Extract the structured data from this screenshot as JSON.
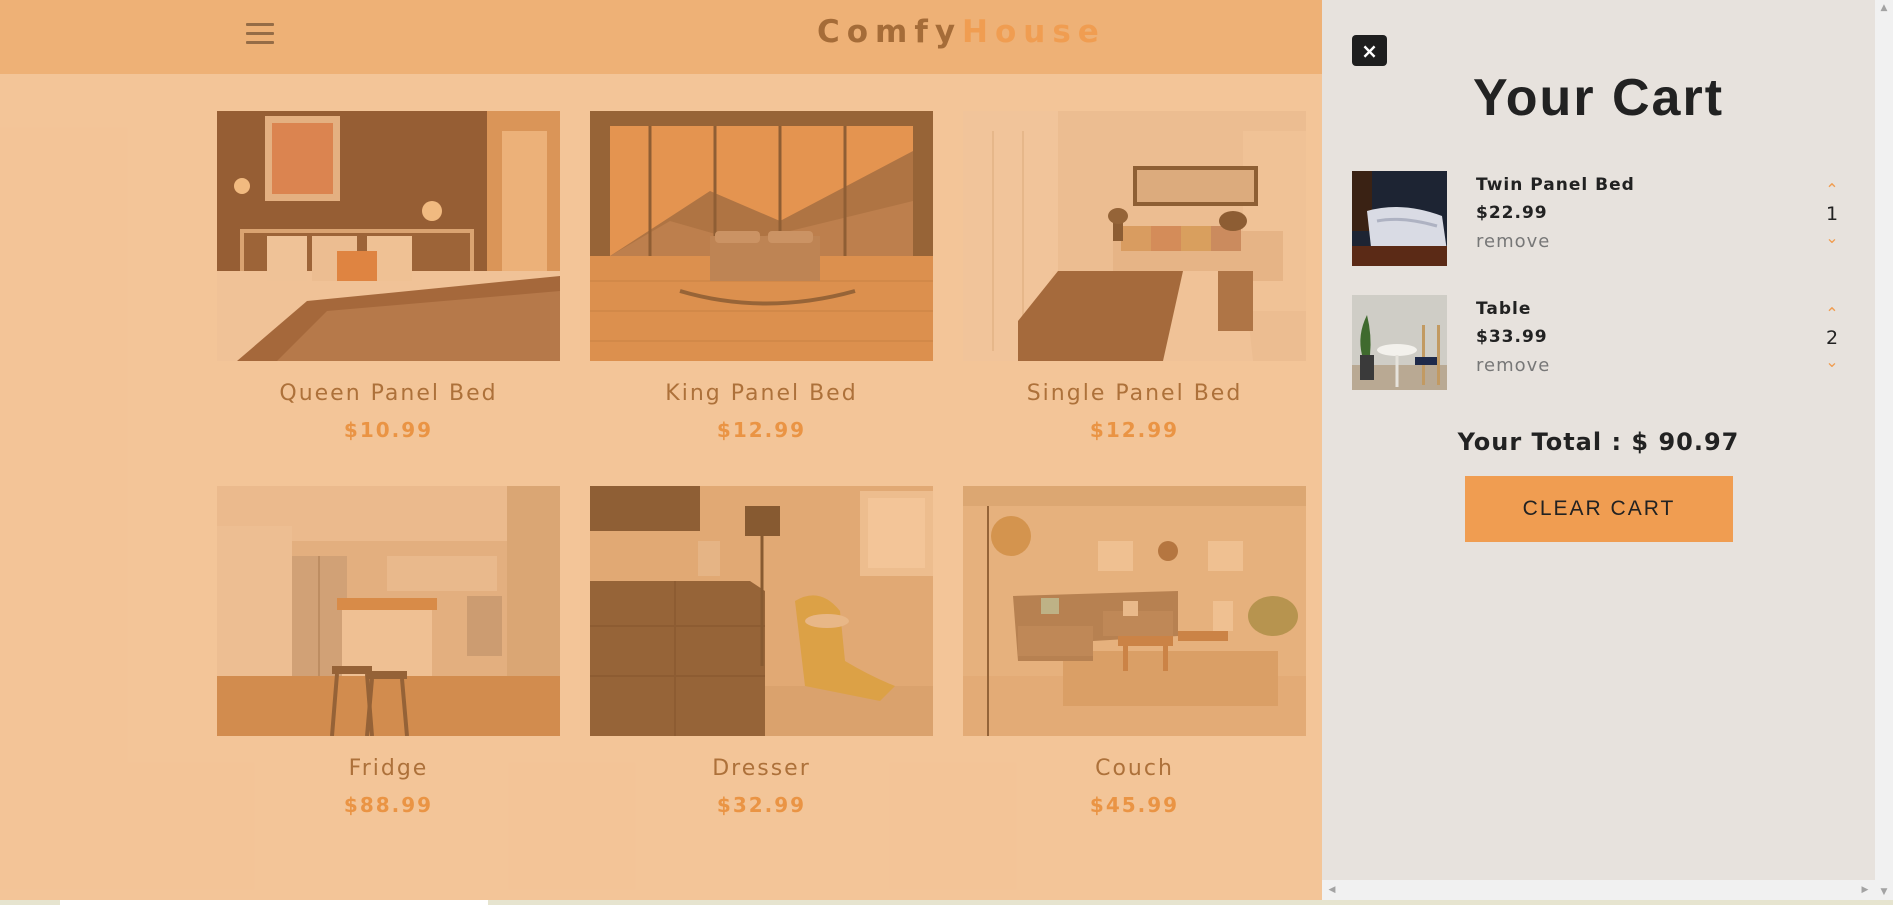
{
  "navbar": {
    "logo_part1": "Comfy",
    "logo_part2": "House"
  },
  "products": [
    {
      "name": "Queen Panel Bed",
      "price": "$10.99"
    },
    {
      "name": "King Panel Bed",
      "price": "$12.99"
    },
    {
      "name": "Single Panel Bed",
      "price": "$12.99"
    },
    {
      "name": "Fridge",
      "price": "$88.99"
    },
    {
      "name": "Dresser",
      "price": "$32.99"
    },
    {
      "name": "Couch",
      "price": "$45.99"
    }
  ],
  "cart": {
    "close_icon": "×",
    "title": "Your Cart",
    "items": [
      {
        "title": "Twin Panel Bed",
        "price": "$22.99",
        "remove_label": "remove",
        "quantity": "1"
      },
      {
        "title": "Table",
        "price": "$33.99",
        "remove_label": "remove",
        "quantity": "2"
      }
    ],
    "total_label": "Your Total : $ 90.97",
    "clear_label": "CLEAR CART"
  },
  "colors": {
    "accent": "#f09d51",
    "navbar": "#ecc49a",
    "cart_bg": "#e7e2dd"
  }
}
